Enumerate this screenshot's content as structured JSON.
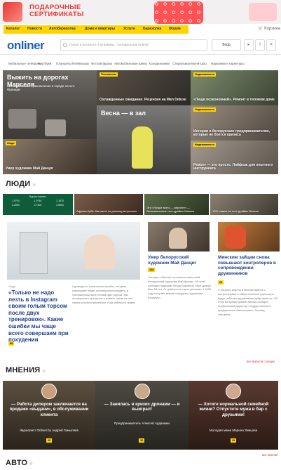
{
  "banner": {
    "title_line1": "ПОДАРОЧНЫЕ",
    "title_line2": "СЕРТИФИКАТЫ"
  },
  "topnav": {
    "items": [
      "Каталог",
      "Новости",
      "Автобарахолка",
      "Дома и квартиры",
      "Услуги",
      "Барахолка",
      "Форум"
    ],
    "cart": "Корзина"
  },
  "header": {
    "logo": "onliner",
    "search_placeholder": "Поиск в Каталоге. Например, \"холодильник Indesit\"",
    "login": "Вход"
  },
  "catnav": [
    "Мобильные телефоны",
    "Ноутбуки",
    "Планшеты",
    "Телевизоры",
    "Фотоаппараты",
    "Автомобильные шины",
    "Холодильники",
    "Стиральные",
    "Мониторы",
    "Наушники и гарнитуры"
  ],
  "top_stories": {
    "main": {
      "title": "Выжить на дорогах Марселя",
      "subtitle": "Автомобильные приключения в городе на юге Франции"
    },
    "t1": {
      "tag": "Технологии",
      "title": "Охлажденные ожидания. Рецензия на Man Deluxe"
    },
    "t2": {
      "tag": "Недвижимость",
      "title": "«Люди поэкономней». Ремонт в типовом доме"
    },
    "t3": {
      "title": "Весна — в зал"
    },
    "t4": {
      "tag": "Недвижимость",
      "title": "Истории о белорусских предпринимателях, которые не боятся кризиса"
    },
    "t5": {
      "tag": "Люди",
      "title": "Умер художник Май Данциг"
    },
    "t6": {
      "tag": "Недвижимость",
      "title": "Ремонт — это просто. Лайфхак для опытного инструмента"
    }
  },
  "people": {
    "heading": "ЛЮДИ",
    "stat_title": "Курсы валют",
    "stats": [
      "1.9700",
      "1.9750",
      "2.1870",
      "2.2000",
      "2.7400",
      "2.8000"
    ],
    "small": [
      "Африка-Куба. Как меня по-разному встречают",
      "Эти «Лучше всего — верните» — Экономические тест-драйвы Минска",
      "10% ставок на тест-драйвы Минска",
      "Мировые предприниматели"
    ],
    "feature": {
      "label": "Люди",
      "title": "«Только не надо лезть в Instagram своим голым торсом после двух тренировок». Какие ошибки мы чаще всего совершаем при похудении",
      "badge": "58",
      "text": "Однажды от количества ошибок, которые совершают люди, пытающиеся похудеть, в тренажерном зале голова идет кругом. Мы поговорили с тренером и узнали, какие из них самые распространенные и как избежать травм."
    },
    "art2": {
      "title": "Умер белорусский художник Май Данциг",
      "badge": "168",
      "text": "Сегодня в Минске скончался известный белорусский художник Май Данциг. Об этом сообщил художник Игорь Барханов. Май Данциг был 85 лет. Он работал в стиле реализм, в 1995 году получил звание народного художника Беларуси."
    },
    "art3": {
      "title": "Минским зайцам снова повышают контролеров в сопровождении дружинников",
      "badge": "24",
      "text": "С первого апреля в Минске вместе с контролерами в общественном транспорте будут работать дружинники добровольцы. Об этом во время прямой линии сообщил генеральный директор государственного предприятия «Минсктранс» Леонид Нагорнов."
    },
    "more": "все новости о людях"
  },
  "opinions": {
    "heading": "МНЕНИЯ",
    "items": [
      {
        "quote": "— Работа дилером заключается на продаже «выдачи», в обслуживании клиента",
        "author": "Журналист Onliner.by Андрей Гамыляев",
        "badge": "45"
      },
      {
        "quote": "— Занялась в кризис дронами — и выиграл!",
        "author": "Предприниматель Алексей Ардашкин",
        "badge": "18"
      },
      {
        "quote": "— Хотите нормальной семейной жизни? Отпустите мужа в бар с друзьями!",
        "author": "Молодая мама Марина Земцова",
        "badge": "29"
      }
    ],
    "more": "все мнения"
  },
  "auto": {
    "heading": "АВТО"
  }
}
